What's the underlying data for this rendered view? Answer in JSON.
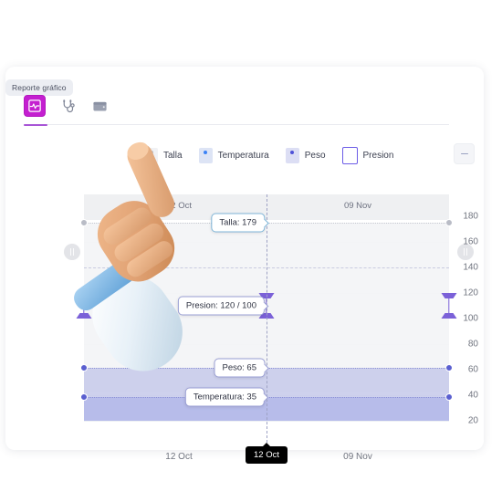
{
  "tooltip_chip": {
    "label": "Reporte gráfico"
  },
  "toolbar": {
    "items": [
      {
        "icon": "pulse-chart-icon",
        "label": "Reporte gráfico",
        "active": true
      },
      {
        "icon": "stethoscope-icon",
        "label": "Consulta",
        "active": false
      },
      {
        "icon": "folder-card-icon",
        "label": "Archivos",
        "active": false
      }
    ],
    "accent_color": "#c41fd0",
    "underline_color": "#a855d6"
  },
  "legend": {
    "items": [
      {
        "label": "Talla",
        "swatch": "#f0f1f4",
        "dot": "#b9bcc6",
        "style": "filled"
      },
      {
        "label": "Temperatura",
        "swatch": "#dde4f5",
        "dot": "#3b82f6",
        "style": "filled"
      },
      {
        "label": "Peso",
        "swatch": "#dcdef4",
        "dot": "#4f52d8",
        "style": "filled"
      },
      {
        "label": "Presion",
        "swatch": "#ffffff",
        "dot": "",
        "style": "outline"
      }
    ]
  },
  "export_button": {
    "name": "collapse-button"
  },
  "nav": {
    "left": "prev-range-button",
    "right": "next-range-button"
  },
  "chart_data": {
    "type": "area",
    "title": "",
    "xlabel": "",
    "ylabel": "",
    "ylim": [
      20,
      190
    ],
    "yticks": [
      180,
      160,
      140,
      120,
      100,
      80,
      60,
      40,
      20
    ],
    "x": [
      "12 Oct",
      "09 Nov"
    ],
    "xticks": [
      "12 Oct",
      "09 Nov"
    ],
    "band_labels": [
      "12 Oct",
      "09 Nov"
    ],
    "grid": true,
    "legend_position": "top",
    "series": [
      {
        "name": "Talla",
        "values": [
          179,
          179
        ],
        "color": "#f0f1f4",
        "marker": "#b9bcc6"
      },
      {
        "name": "Presion",
        "values": [
          120,
          100
        ],
        "color": "#7b61d8",
        "marker": "#7b61d8",
        "range": [
          100,
          120
        ]
      },
      {
        "name": "Peso",
        "values": [
          65,
          70
        ],
        "color": "#c5c9ea",
        "marker": "#5a5fd0"
      },
      {
        "name": "Temperatura",
        "values": [
          35,
          37
        ],
        "color": "#b5baea",
        "marker": "#5a5fd0"
      }
    ],
    "tooltips": [
      {
        "label": "Talla: 179",
        "series": "Talla"
      },
      {
        "label": "Presion: 120 / 100",
        "series": "Presion"
      },
      {
        "label": "Peso: 65",
        "series": "Peso"
      },
      {
        "label": "Temperatura: 35",
        "series": "Temperatura"
      }
    ],
    "x_cursor_tooltip": "12 Oct"
  }
}
